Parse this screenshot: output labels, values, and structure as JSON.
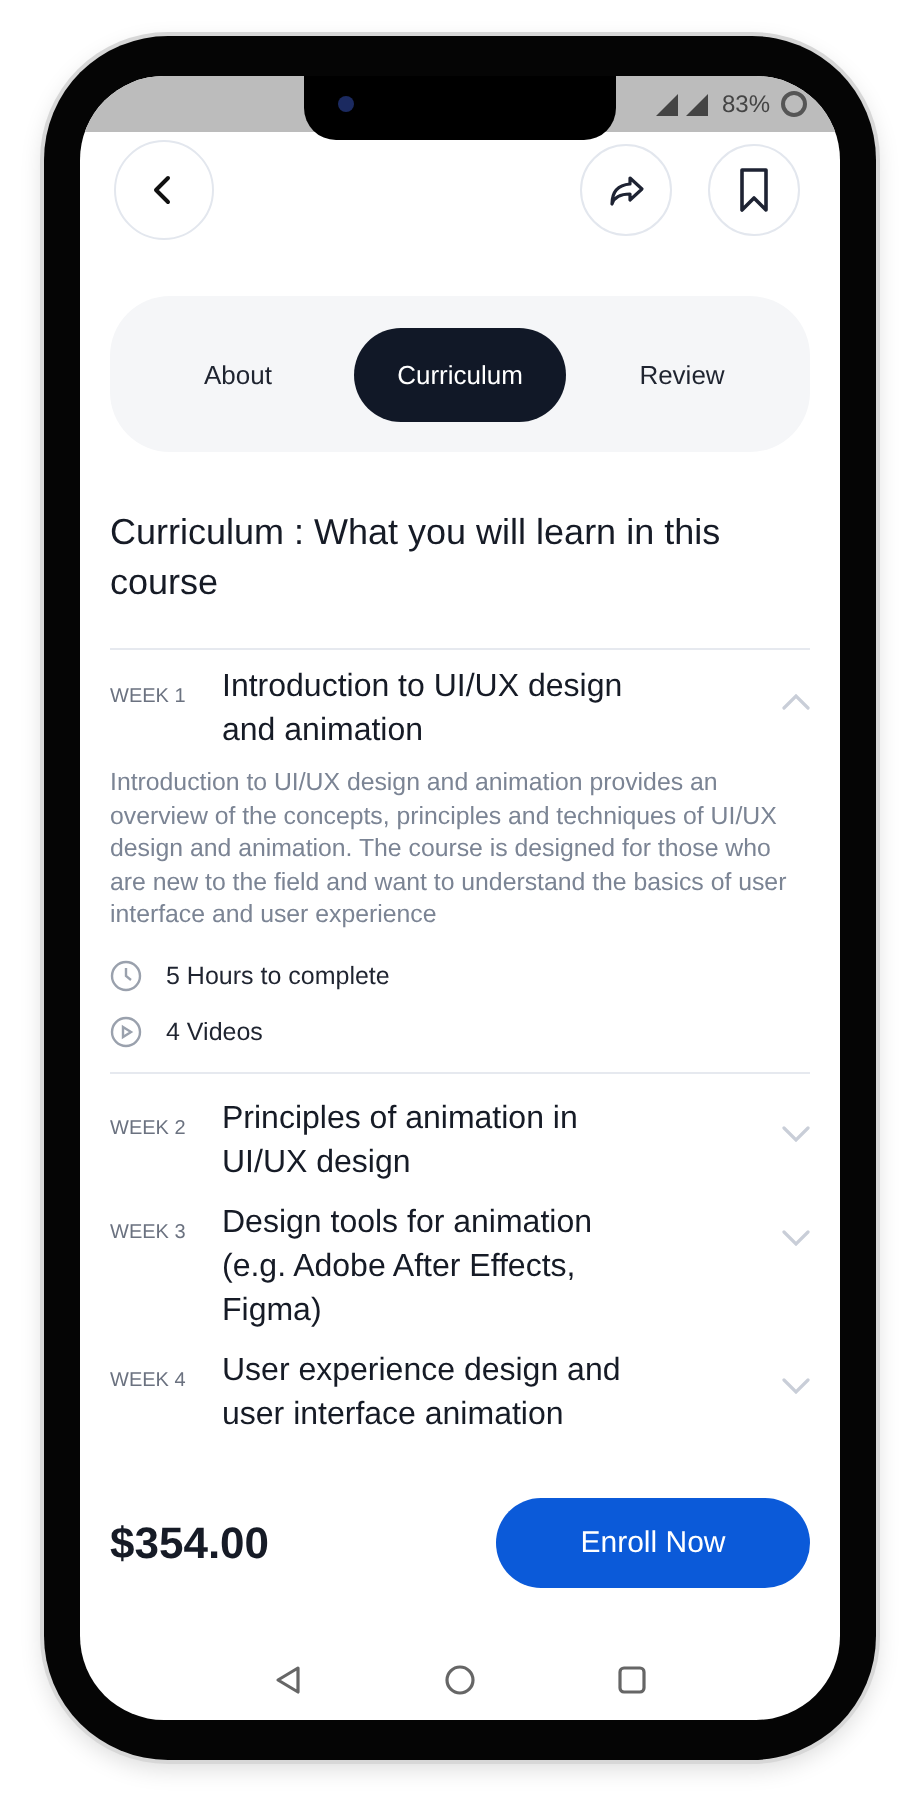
{
  "status_bar": {
    "battery": "83%"
  },
  "tabs": [
    {
      "label": "About",
      "selected": false
    },
    {
      "label": "Curriculum",
      "selected": true
    },
    {
      "label": "Review",
      "selected": false
    }
  ],
  "heading": "Curriculum : What you will learn in this course",
  "weeks": [
    {
      "week": "WEEK 1",
      "title": "Introduction to UI/UX design and animation",
      "expanded": true,
      "description": "Introduction to UI/UX design and animation provides an overview of the concepts, principles and techniques of UI/UX design and animation. The course is designed for those who are new to the field and want to understand the basics of user interface and user experience",
      "details": [
        {
          "kind": "duration",
          "text": "5 Hours to complete"
        },
        {
          "kind": "videos",
          "text": "4 Videos"
        }
      ]
    },
    {
      "week": "WEEK 2",
      "title": "Principles of animation in UI/UX design",
      "expanded": false
    },
    {
      "week": "WEEK 3",
      "title": "Design tools for animation (e.g. Adobe After Effects, Figma)",
      "expanded": false
    },
    {
      "week": "WEEK 4",
      "title": "User experience design and user interface animation",
      "expanded": false
    }
  ],
  "footer": {
    "price": "$354.00",
    "button": "Enroll Now"
  }
}
